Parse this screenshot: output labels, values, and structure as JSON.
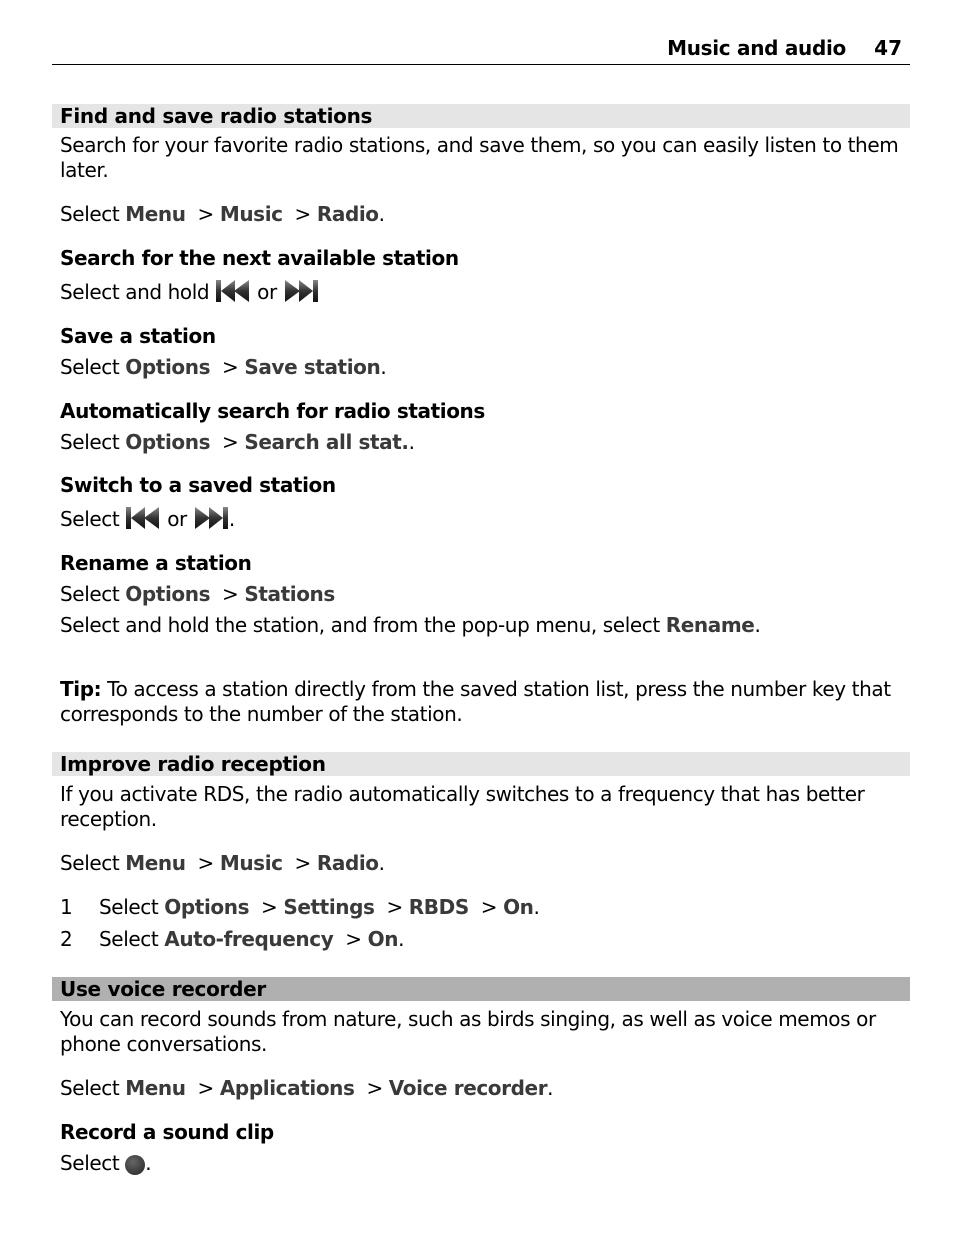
{
  "header": {
    "chapter": "Music and audio",
    "page": "47"
  },
  "sections": [
    {
      "title": "Find and save radio stations",
      "intro": [
        "Search for your favorite radio stations, and save them, so you can easily listen to them",
        "later."
      ],
      "path": {
        "prefix": "Select ",
        "items": [
          "Menu",
          "Music",
          "Radio"
        ]
      },
      "tasks": [
        {
          "title": "Search for the next available station",
          "text_before": "Select and hold ",
          "or": " or ",
          "icons": [
            "rewind-icon",
            "fast-forward-icon"
          ]
        },
        {
          "title": "Save a station",
          "prefix": "Select ",
          "items": [
            "Options",
            "Save station"
          ]
        },
        {
          "title": "Automatically search for radio stations",
          "prefix": "Select ",
          "items": [
            "Options",
            "Search all stat."
          ]
        },
        {
          "title": "Switch to a saved station",
          "text_before": "Select ",
          "or": " or ",
          "icons": [
            "rewind-icon",
            "fast-forward-icon"
          ]
        },
        {
          "title": "Rename a station",
          "prefix": "Select ",
          "items": [
            "Options",
            "Stations"
          ],
          "extra": "Select and hold the station, and from the pop-up menu, select ",
          "extra_bold": "Rename"
        }
      ],
      "tip_label": "Tip:",
      "tip": [
        " To access a station directly from the saved station list, press the number key that",
        "corresponds to the number of the station."
      ]
    },
    {
      "title": "Improve radio reception",
      "intro": [
        "If you activate RDS, the radio automatically switches to a frequency that has better",
        "reception."
      ],
      "path": {
        "prefix": "Select ",
        "items": [
          "Menu",
          "Music",
          "Radio"
        ]
      },
      "steps": [
        {
          "n": "1",
          "prefix": "Select ",
          "items": [
            "Options",
            "Settings",
            "RBDS",
            "On"
          ]
        },
        {
          "n": "2",
          "prefix": "Select ",
          "items": [
            "Auto-frequency",
            "On"
          ]
        }
      ]
    },
    {
      "title": "Use voice recorder",
      "intro": [
        "You can record sounds from nature, such as birds singing, as well as voice memos or",
        "phone conversations."
      ],
      "path": {
        "prefix": "Select ",
        "items": [
          "Menu",
          "Applications",
          "Voice recorder"
        ]
      },
      "tasks": [
        {
          "title": "Record a sound clip",
          "text_before": "Select ",
          "icon": "record-icon"
        }
      ]
    }
  ],
  "separator": " > ",
  "period": "."
}
